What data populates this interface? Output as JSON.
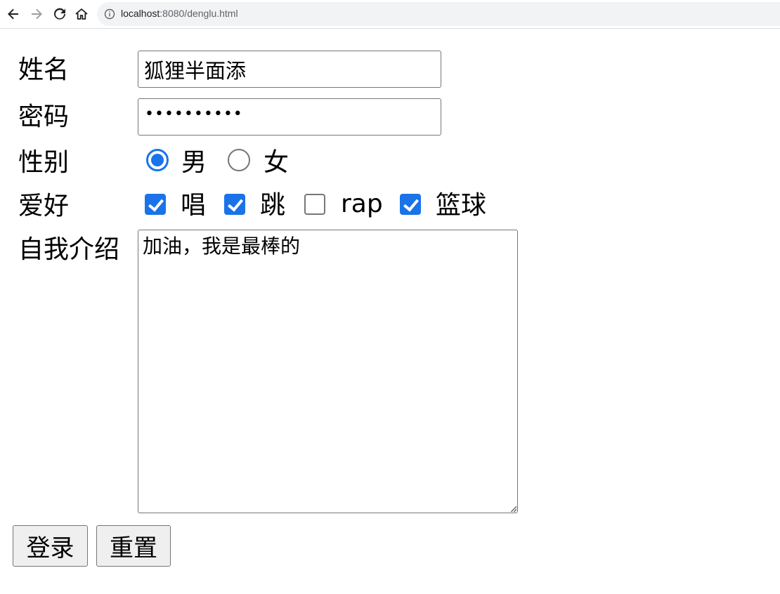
{
  "browser": {
    "url_host": "localhost",
    "url_rest": ":8080/denglu.html"
  },
  "form": {
    "name": {
      "label": "姓名",
      "value": "狐狸半面添"
    },
    "password": {
      "label": "密码",
      "masked": "••••••••••"
    },
    "gender": {
      "label": "性别",
      "options": [
        {
          "label": "男",
          "checked": true
        },
        {
          "label": "女",
          "checked": false
        }
      ]
    },
    "hobbies": {
      "label": "爱好",
      "options": [
        {
          "label": "唱",
          "checked": true
        },
        {
          "label": "跳",
          "checked": true
        },
        {
          "label": "rap",
          "checked": false
        },
        {
          "label": "篮球",
          "checked": true
        }
      ]
    },
    "intro": {
      "label": "自我介绍",
      "value": "加油，我是最棒的"
    },
    "buttons": {
      "login": "登录",
      "reset": "重置"
    }
  },
  "colors": {
    "accent": "#1a73e8",
    "border": "#767676",
    "button_bg": "#efefef"
  }
}
